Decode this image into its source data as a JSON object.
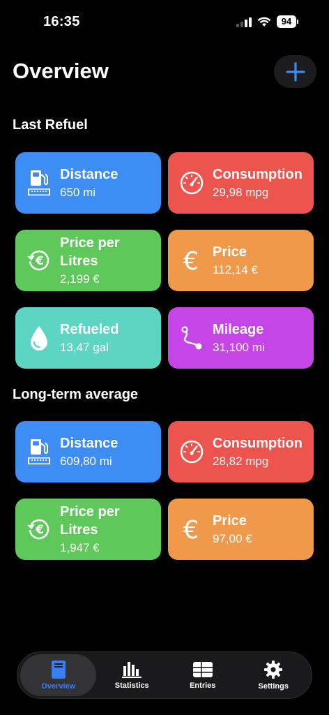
{
  "status": {
    "time": "16:35",
    "battery": "94"
  },
  "header": {
    "title": "Overview"
  },
  "sections": {
    "last_refuel": {
      "title": "Last Refuel",
      "cards": [
        {
          "label": "Distance",
          "value": "650 mi",
          "color": "#3d8df5",
          "icon": "fuel-pump-icon"
        },
        {
          "label": "Consumption",
          "value": "29,98 mpg",
          "color": "#ee544e",
          "icon": "gauge-icon"
        },
        {
          "label": "Price per Litres",
          "value": "2,199 €",
          "color": "#5ec85a",
          "icon": "euro-refresh-icon"
        },
        {
          "label": "Price",
          "value": "112,14 €",
          "color": "#f0994a",
          "icon": "euro-icon"
        },
        {
          "label": "Refueled",
          "value": "13,47 gal",
          "color": "#5dd5c4",
          "icon": "drop-icon"
        },
        {
          "label": "Mileage",
          "value": "31,100 mi",
          "color": "#c545e6",
          "icon": "route-icon"
        }
      ]
    },
    "long_term": {
      "title": "Long-term average",
      "cards": [
        {
          "label": "Distance",
          "value": "609,80 mi",
          "color": "#3d8df5",
          "icon": "fuel-pump-icon"
        },
        {
          "label": "Consumption",
          "value": "28,82 mpg",
          "color": "#ee544e",
          "icon": "gauge-icon"
        },
        {
          "label": "Price per Litres",
          "value": "1,947 €",
          "color": "#5ec85a",
          "icon": "euro-refresh-icon"
        },
        {
          "label": "Price",
          "value": "97,00 €",
          "color": "#f0994a",
          "icon": "euro-icon"
        }
      ]
    }
  },
  "tabs": [
    {
      "label": "Overview",
      "active": true,
      "icon": "fuel-pump-icon"
    },
    {
      "label": "Statistics",
      "active": false,
      "icon": "bar-chart-icon"
    },
    {
      "label": "Entries",
      "active": false,
      "icon": "table-icon"
    },
    {
      "label": "Settings",
      "active": false,
      "icon": "gear-icon"
    }
  ]
}
